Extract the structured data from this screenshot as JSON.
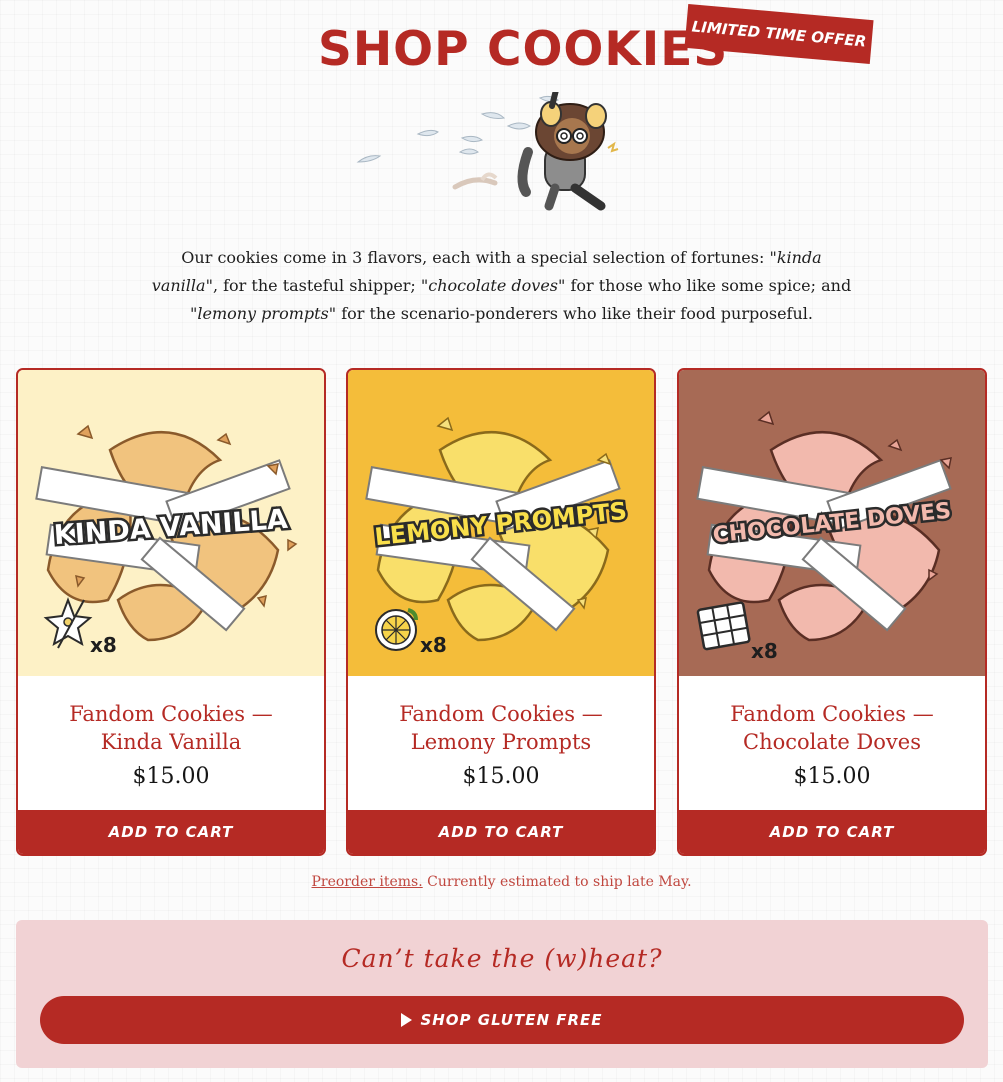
{
  "header": {
    "title": "SHOP COOKIES",
    "badge": "LIMITED TIME OFFER"
  },
  "intro": {
    "part1": "Our cookies come in 3 flavors, each with a special selection of fortunes: ",
    "flavor1": "\"kinda vanilla\"",
    "part2": ", for the tasteful shipper; ",
    "flavor2": "\"chocolate doves\"",
    "part3": " for those who like some spice; and ",
    "flavor3": "\"lemony prompts\"",
    "part4": " for the scenario-ponderers who like their food purposeful."
  },
  "products": [
    {
      "art_label": "KINDA VANILLA",
      "count": "x8",
      "name_line1": "Fandom Cookies —",
      "name_line2": "Kinda Vanilla",
      "price": "$15.00",
      "cart_label": "ADD TO CART",
      "bg": "#fdf1c6",
      "cookie": "#f1c37e",
      "icon": "vanilla-flower-icon"
    },
    {
      "art_label": "LEMONY PROMPTS",
      "count": "x8",
      "name_line1": "Fandom Cookies —",
      "name_line2": "Lemony Prompts",
      "price": "$15.00",
      "cart_label": "ADD TO CART",
      "bg": "#f4bd3a",
      "cookie": "#f9df6a",
      "icon": "lemon-slice-icon"
    },
    {
      "art_label": "CHOCOLATE DOVES",
      "count": "x8",
      "name_line1": "Fandom Cookies —",
      "name_line2": "Chocolate Doves",
      "price": "$15.00",
      "cart_label": "ADD TO CART",
      "bg": "#a76a55",
      "cookie": "#f2b9ad",
      "icon": "chocolate-bar-icon"
    }
  ],
  "preorder": {
    "link": "Preorder items.",
    "note": " Currently estimated to ship late May."
  },
  "gluten_free": {
    "heading": "Can’t take the (w)heat?",
    "button": "SHOP GLUTEN FREE"
  },
  "colors": {
    "accent": "#b52a24",
    "panel": "#f1d2d4"
  }
}
